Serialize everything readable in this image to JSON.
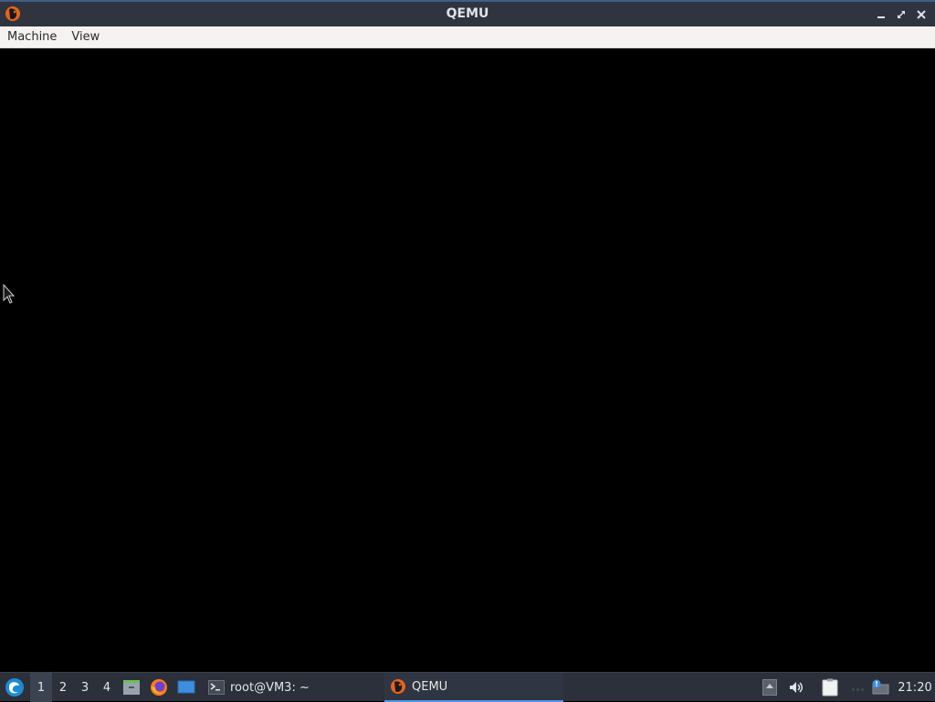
{
  "window": {
    "title": "QEMU"
  },
  "menubar": {
    "items": [
      {
        "label": "Machine"
      },
      {
        "label": "View"
      }
    ]
  },
  "taskbar": {
    "workspaces": [
      "1",
      "2",
      "3",
      "4"
    ],
    "active_workspace": "1",
    "tasks": [
      {
        "label": "root@VM3: ~",
        "icon": "terminal-icon"
      },
      {
        "label": "QEMU",
        "icon": "qemu-icon"
      }
    ],
    "clock": "21:20"
  },
  "colors": {
    "titlebar": "#2f343f",
    "titlebar_accent": "#3f5d88",
    "taskbar": "#2b303b",
    "active_task_underline": "#5294e2",
    "display_bg": "#000000"
  }
}
